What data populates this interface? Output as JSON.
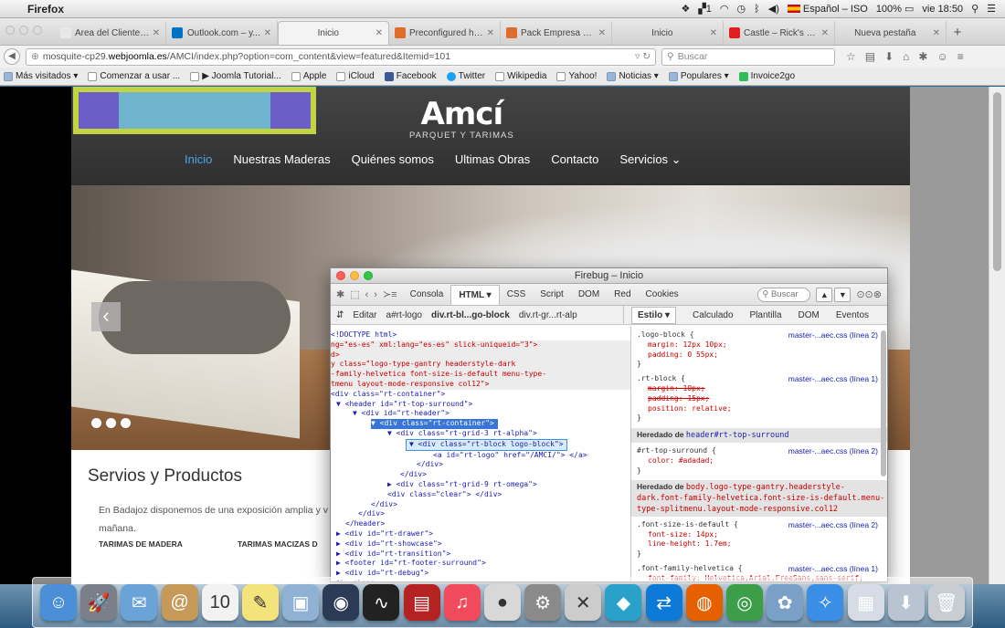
{
  "menubar": {
    "app": "Firefox",
    "input_source": "Español – ISO",
    "battery": "100%",
    "clock": "vie 18:50"
  },
  "tabs": [
    {
      "label": "Área del Cliente – H...",
      "favicon_color": "#e8e8e8",
      "active": false
    },
    {
      "label": "Outlook.com – y...",
      "favicon_color": "#0072c6",
      "active": false
    },
    {
      "label": "Inicio",
      "favicon_color": "",
      "active": true
    },
    {
      "label": "Preconfigured ht...",
      "favicon_color": "#e06c2c",
      "active": false
    },
    {
      "label": "Pack Empresa En...",
      "favicon_color": "#e06c2c",
      "active": false
    },
    {
      "label": "Inicio",
      "favicon_color": "",
      "active": false
    },
    {
      "label": "Castle – Rick's st...",
      "favicon_color": "#e02020",
      "active": false
    },
    {
      "label": "Nueva pestaña",
      "favicon_color": "",
      "active": false
    }
  ],
  "navbar": {
    "url_prefix": "mosquite-cp29.",
    "url_domain": "webjoomla.es",
    "url_rest": "/AMCI/index.php?option=com_content&view=featured&Itemid=101",
    "search_placeholder": "Buscar"
  },
  "bookmarks": [
    {
      "label": "Más visitados ▾",
      "icon": "folder"
    },
    {
      "label": "Comenzar a usar ...",
      "icon": "page"
    },
    {
      "label": "▶ Joomla Tutorial...",
      "icon": "page"
    },
    {
      "label": "Apple",
      "icon": "page"
    },
    {
      "label": "iCloud",
      "icon": "page"
    },
    {
      "label": "Facebook",
      "icon": "fb"
    },
    {
      "label": "Twitter",
      "icon": "tw"
    },
    {
      "label": "Wikipedia",
      "icon": "page"
    },
    {
      "label": "Yahoo!",
      "icon": "page"
    },
    {
      "label": "Noticias ▾",
      "icon": "folder"
    },
    {
      "label": "Populares ▾",
      "icon": "folder"
    },
    {
      "label": "Invoice2go",
      "icon": "green"
    }
  ],
  "site": {
    "brand_name": "Amcí",
    "brand_sub": "PARQUET Y TARIMAS",
    "nav": [
      "Inicio",
      "Nuestras Maderas",
      "Quiénes somos",
      "Ultimas Obras",
      "Contacto",
      "Servicios ⌄"
    ],
    "section_title": "Servios y Productos",
    "paragraph": "En Badajoz disponemos de una exposición amplia y v mañana.",
    "columns": [
      "TARIMAS DE MADERA",
      "TARIMAS MACIZAS D"
    ]
  },
  "firebug": {
    "title": "Firebug – Inicio",
    "tabs": [
      "Consola",
      "HTML ▾",
      "CSS",
      "Script",
      "DOM",
      "Red",
      "Cookies"
    ],
    "search_placeholder": "Buscar",
    "edit_label": "Editar",
    "breadcrumb": [
      "a#rt-logo",
      "div.rt-bl...go-block",
      "div.rt-gr...rt-alp"
    ],
    "side_tabs": [
      "Estilo ▾",
      "Calculado",
      "Plantilla",
      "DOM",
      "Eventos"
    ],
    "html_lines": [
      "<!DOCTYPE html>",
      "ng=\"es-es\" xml:lang=\"es-es\" slick-uniqueid=\"3\">",
      "d>",
      "y class=\"logo-type-gantry headerstyle-dark",
      "-family-helvetica font-size-is-default menu-type-",
      "tmenu layout-mode-responsive col12\">",
      "<div class=\"rt-container\">",
      "▼ <header id=\"rt-top-surround\">",
      "▼ <div id=\"rt-header\">",
      "▼ <div class=\"rt-container\">",
      "▼ <div class=\"rt-grid-3 rt-alpha\">",
      "▼ <div class=\"rt-block logo-block\">",
      "<a id=\"rt-logo\" href=\"/AMCI/\"> </a>",
      "</div>",
      "</div>",
      "▶ <div class=\"rt-grid-9 rt-omega\">",
      "<div class=\"clear\"> </div>",
      "</div>",
      "</div>",
      "</header>",
      "▶ <div id=\"rt-drawer\">",
      "▶ <div id=\"rt-showcase\">",
      "▶ <div id=\"rt-transition\">",
      "▶ <footer id=\"rt-footer-surround\">",
      "▶ <div id=\"rt-debug\">",
      "<div class=..."
    ],
    "style_rules": {
      "r1_sel": ".logo-block {",
      "r1_src": "master-...aec.css (línea 2)",
      "r1_p1": "margin: 12px 10px;",
      "r1_p2": "padding: 0 55px;",
      "r2_sel": ".rt-block {",
      "r2_src": "master-...aec.css (línea 1)",
      "r2_p1": "margin: 10px;",
      "r2_p2": "padding: 15px;",
      "r2_p3": "position: relative;",
      "inh1_label": "Heredado de",
      "inh1_ref": "header#rt-top-surround",
      "r3_sel": "#rt-top-surround {",
      "r3_src": "master-...aec.css (línea 2)",
      "r3_p1": "color: #adadad;",
      "inh2_label": "Heredado de",
      "inh2_ref": "body.logo-type-gantry.headerstyle-dark.font-family-helvetica.font-size-is-default.menu-type-splitmenu.layout-mode-responsive.col12",
      "r4_sel": ".font-size-is-default {",
      "r4_src": "master-...aec.css (línea 2)",
      "r4_p1": "font-size: 14px;",
      "r4_p2": "line-height: 1.7em;",
      "r5_sel": ".font-family-helvetica {",
      "r5_src": "master-...aec.css (línea 1)",
      "r5_p1": "font-family: Helvetica,Arial,FreeSans,sans-serif;"
    }
  },
  "dock": [
    {
      "name": "finder-icon",
      "color": "#4b8fd6",
      "glyph": "☺"
    },
    {
      "name": "launchpad-icon",
      "color": "#7a7f89",
      "glyph": "🚀"
    },
    {
      "name": "mail-icon",
      "color": "#6aa3d8",
      "glyph": "✉"
    },
    {
      "name": "contacts-icon",
      "color": "#c59a58",
      "glyph": "@"
    },
    {
      "name": "calendar-icon",
      "color": "#f2f2f2",
      "glyph": "10"
    },
    {
      "name": "notes-icon",
      "color": "#f4e27a",
      "glyph": "✎"
    },
    {
      "name": "preview-icon",
      "color": "#8fb2d4",
      "glyph": "▣"
    },
    {
      "name": "quicktime-icon",
      "color": "#2b3b55",
      "glyph": "◉"
    },
    {
      "name": "activity-monitor-icon",
      "color": "#222222",
      "glyph": "∿"
    },
    {
      "name": "photo-booth-icon",
      "color": "#b52222",
      "glyph": "▤"
    },
    {
      "name": "itunes-icon",
      "color": "#f04a5c",
      "glyph": "♫"
    },
    {
      "name": "dvd-player-icon",
      "color": "#d8d8d8",
      "glyph": "●"
    },
    {
      "name": "system-preferences-icon",
      "color": "#8a8a8a",
      "glyph": "⚙"
    },
    {
      "name": "xcode-icon",
      "color": "#cccccc",
      "glyph": "✕"
    },
    {
      "name": "app-icon",
      "color": "#2aa1c9",
      "glyph": "◆"
    },
    {
      "name": "teamviewer-icon",
      "color": "#0e7ad8",
      "glyph": "⇄"
    },
    {
      "name": "firefox-icon",
      "color": "#e66000",
      "glyph": "◍"
    },
    {
      "name": "chrome-icon",
      "color": "#3d9e4a",
      "glyph": "◎"
    },
    {
      "name": "photos-icon",
      "color": "#7aa0c8",
      "glyph": "✿"
    },
    {
      "name": "safari-icon",
      "color": "#3a8ee6",
      "glyph": "✧"
    },
    {
      "name": "documents-folder-icon",
      "color": "#d5dce6",
      "glyph": "▦"
    },
    {
      "name": "downloads-folder-icon",
      "color": "#b8c4d2",
      "glyph": "⬇"
    },
    {
      "name": "trash-icon",
      "color": "#c8cdd3",
      "glyph": "🗑"
    }
  ]
}
